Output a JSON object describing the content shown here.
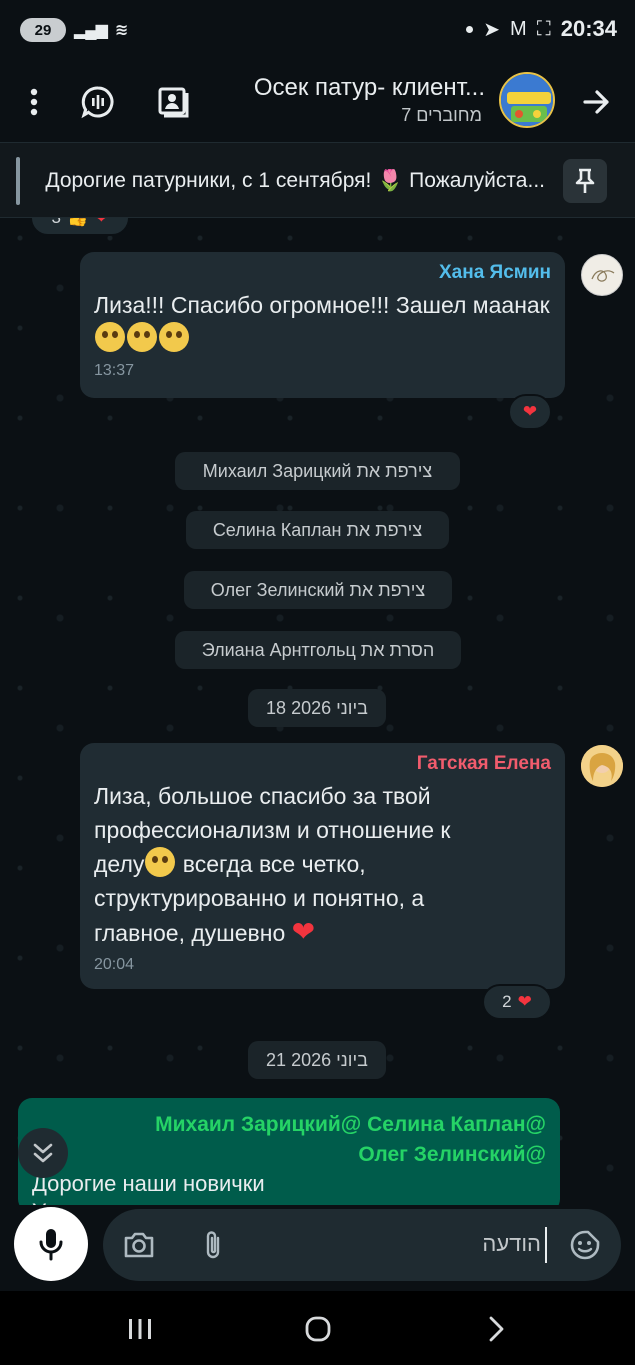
{
  "statusbar": {
    "battery": "29",
    "time": "20:34"
  },
  "header": {
    "title": "Осек патур- клиент...",
    "subtitle": "7 מחוברים"
  },
  "pinned": {
    "text": "...Дорогие патурники, с 1 сентября! 🌷 Пожалуйста"
  },
  "messages": [
    {
      "sender": "Хана Ясмин",
      "sender_color": "#53bdeb",
      "text": "Лиза!!! Спасибо огромное!!! Зашел маанак",
      "emoji_count": 3,
      "time": "13:37",
      "reaction": "❤️"
    },
    {
      "sender": "Гатская Елена",
      "sender_color": "#f15c6d",
      "text_a": "Лиза, большое спасибо за твой профессионализм и отношение к делу",
      "text_b": " всегда все четко, структурированно и понятно, а главное, душевно ",
      "time": "20:04",
      "reaction_count": "2",
      "reaction": "❤️"
    }
  ],
  "system": [
    {
      "name": "Михаил Зарицкий",
      "action": "צירפת את"
    },
    {
      "name": "Селина Каплан",
      "action": "צירפת את"
    },
    {
      "name": "Олег Зелинский",
      "action": "צירפת את"
    },
    {
      "name": "Элиана Арнтгольц",
      "action": "הסרת את"
    }
  ],
  "dates": [
    "18 ביוני 2026",
    "21 ביוני 2026"
  ],
  "outgoing": {
    "mentions_line1": "Михаил Зарицкий@ Селина Каплан@",
    "mentions_line2": "Олег Зелинский@",
    "text_line1": "Дорогие наши новички",
    "text_line2": "У нас период отчетов"
  },
  "composer": {
    "placeholder": "הודעה"
  },
  "colors": {
    "incoming": "#202c33",
    "outgoing": "#005c4b",
    "accent": "#25d366"
  }
}
